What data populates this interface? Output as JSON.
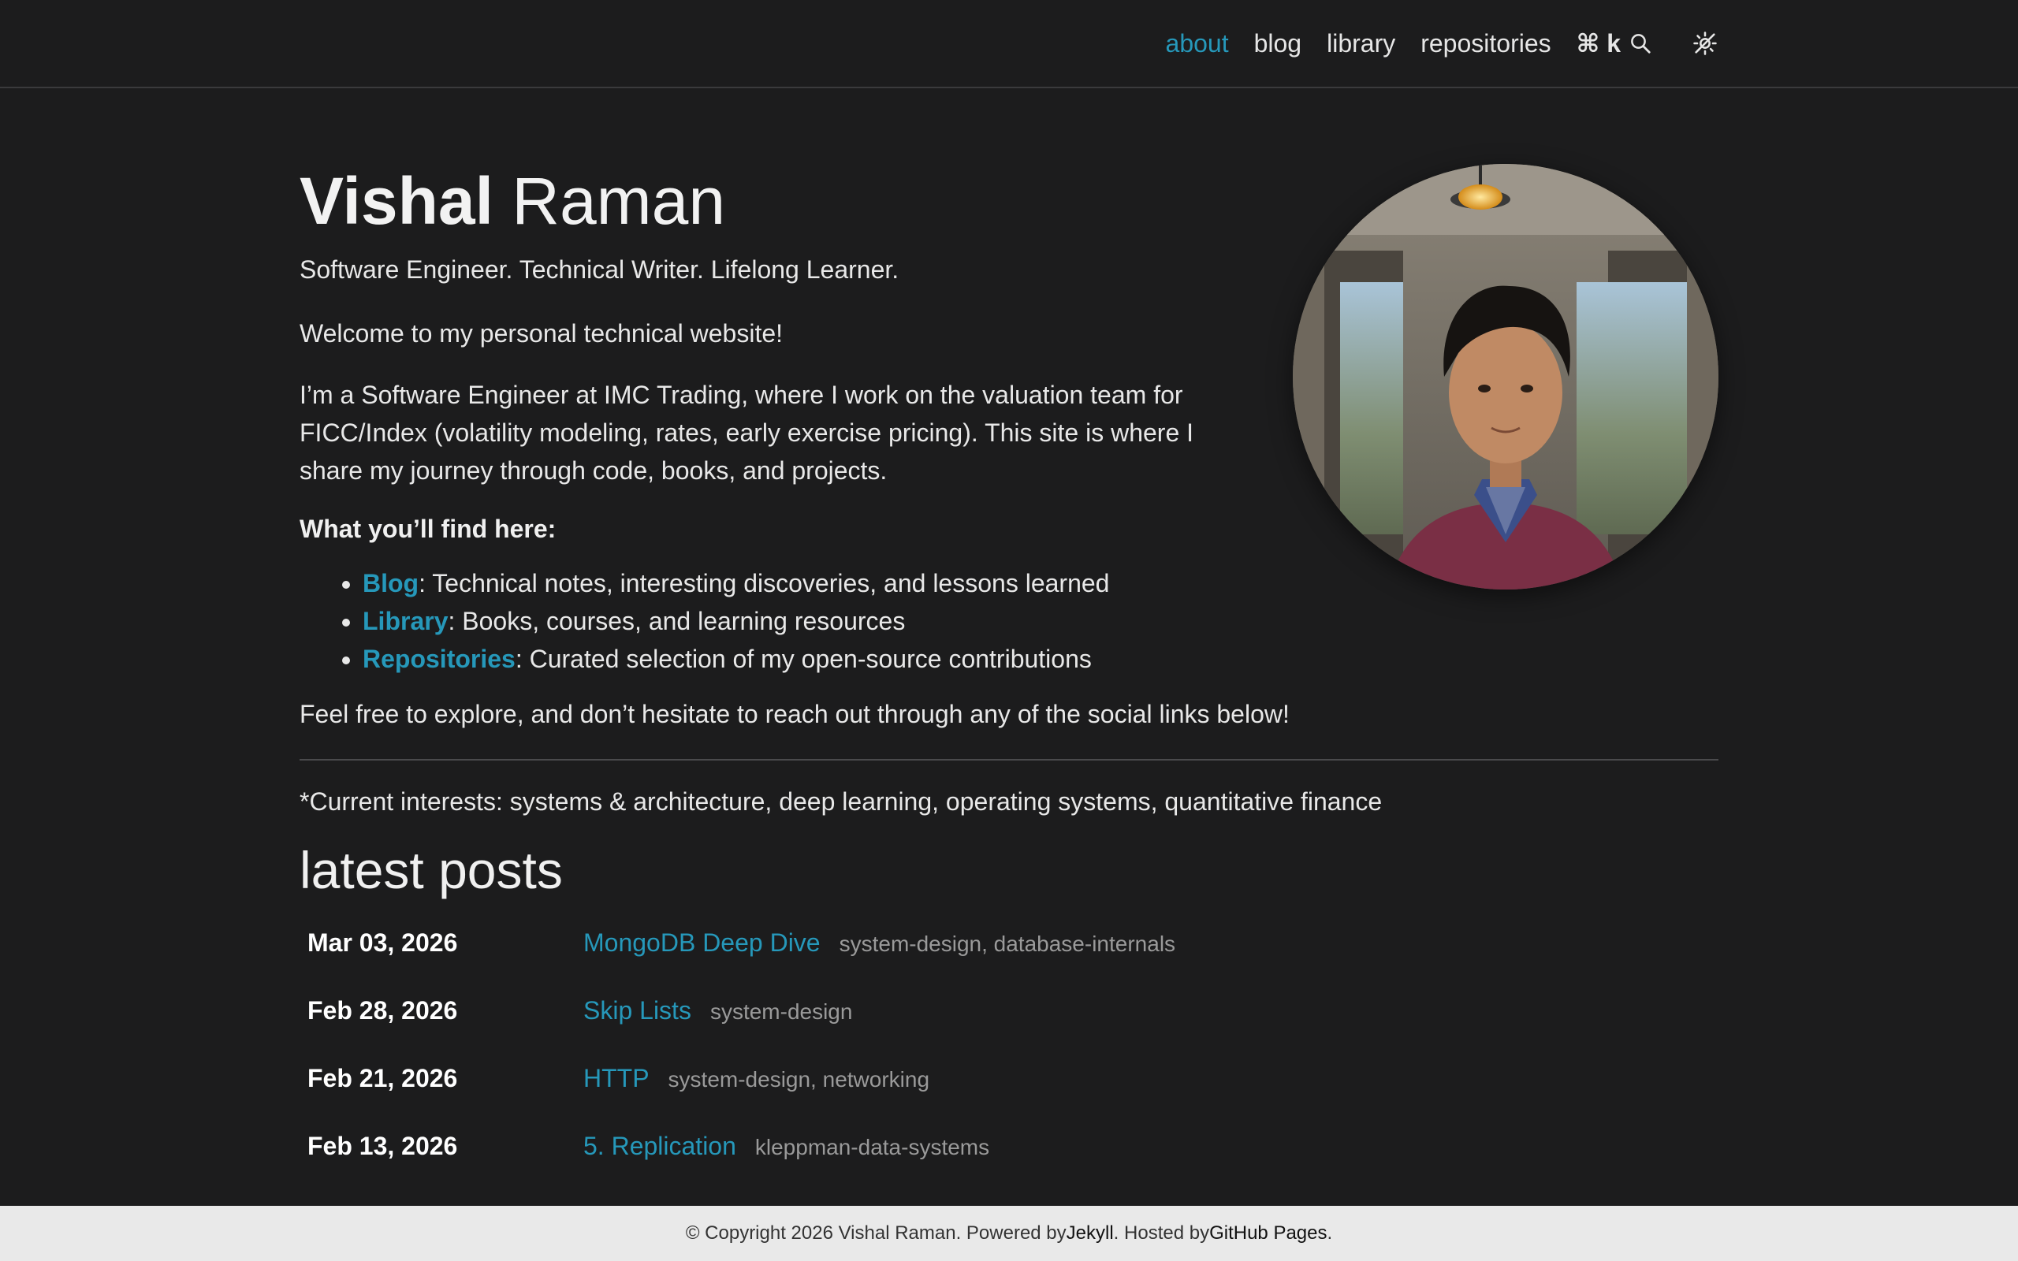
{
  "nav": {
    "items": [
      {
        "label": "about",
        "active": true
      },
      {
        "label": "blog"
      },
      {
        "label": "library"
      },
      {
        "label": "repositories"
      }
    ],
    "search_shortcut": "⌘ k",
    "search_icon": "search-icon",
    "theme_icon": "theme-toggle-icon",
    "accent_color": "#2698ba"
  },
  "profile": {
    "first_name": "Vishal",
    "last_name": "Raman",
    "tagline": "Software Engineer. Technical Writer. Lifelong Learner.",
    "welcome": "Welcome to my personal technical website!",
    "intro": "I’m a Software Engineer at IMC Trading, where I work on the valuation team for FICC/Index (volatility modeling, rates, early exercise pricing). This site is where I share my journey through code, books, and projects.",
    "find_heading": "What you’ll find here:",
    "find_items": [
      {
        "link": "Blog",
        "text": ": Technical notes, interesting discoveries, and lessons learned"
      },
      {
        "link": "Library",
        "text": ": Books, courses, and learning resources"
      },
      {
        "link": "Repositories",
        "text": ": Curated selection of my open-source contributions"
      }
    ],
    "outro": "Feel free to explore, and don’t hesitate to reach out through any of the social links below!",
    "interests": "*Current interests: systems & architecture, deep learning, operating systems, quantitative finance"
  },
  "latest_posts": {
    "heading": "latest posts",
    "items": [
      {
        "date": "Mar 03, 2026",
        "title": "MongoDB Deep Dive",
        "tags": "system-design, database-internals"
      },
      {
        "date": "Feb 28, 2026",
        "title": "Skip Lists",
        "tags": "system-design"
      },
      {
        "date": "Feb 21, 2026",
        "title": "HTTP",
        "tags": "system-design, networking"
      },
      {
        "date": "Feb 13, 2026",
        "title": "5. Replication",
        "tags": "kleppman-data-systems"
      }
    ]
  },
  "footer": {
    "prefix": "© Copyright 2026 Vishal Raman. Powered by ",
    "jekyll": "Jekyll",
    "mid": ". Hosted by ",
    "github": "GitHub Pages",
    "suffix": "."
  }
}
